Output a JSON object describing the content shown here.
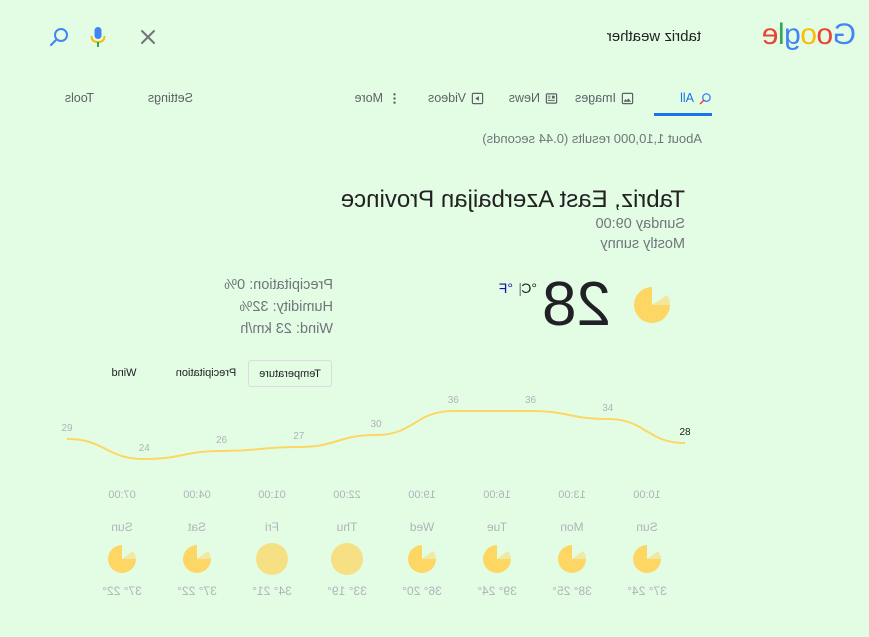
{
  "search": {
    "query": "tabriz weather",
    "logo_letters": [
      {
        "ch": "G",
        "color": "#4285f4"
      },
      {
        "ch": "o",
        "color": "#ea4335"
      },
      {
        "ch": "o",
        "color": "#fbbc05"
      },
      {
        "ch": "g",
        "color": "#4285f4"
      },
      {
        "ch": "l",
        "color": "#34a853"
      },
      {
        "ch": "e",
        "color": "#ea4335"
      }
    ]
  },
  "tabs": {
    "all": "All",
    "images": "Images",
    "news": "News",
    "videos": "Videos",
    "more": "More",
    "settings": "Settings",
    "tools": "Tools"
  },
  "result_stats": "About 1,10,000 results (0.44 seconds)",
  "weather": {
    "location": "Tabriz, East Azerbaijan Province",
    "datetime": "Sunday 09:00",
    "condition": "Mostly sunny",
    "temperature": "28",
    "unit_c": "°C",
    "unit_sep": "|",
    "unit_f": "°F",
    "precipitation": "Precipitation: 0%",
    "humidity": "Humidity: 32%",
    "wind": "Wind: 23 km/h",
    "graph_tabs": {
      "temperature": "Temperature",
      "precipitation": "Precipitation",
      "wind": "Wind"
    },
    "hours": [
      "10:00",
      "13:00",
      "16:00",
      "19:00",
      "22:00",
      "01:00",
      "04:00",
      "07:00"
    ],
    "days": [
      {
        "name": "Sun",
        "icon": "partly-sunny-icon",
        "temps": "37° 24°"
      },
      {
        "name": "Mon",
        "icon": "partly-sunny-icon",
        "temps": "38° 25°"
      },
      {
        "name": "Tue",
        "icon": "partly-sunny-icon",
        "temps": "39° 24°"
      },
      {
        "name": "Wed",
        "icon": "partly-sunny-icon",
        "temps": "36° 20°"
      },
      {
        "name": "Thu",
        "icon": "sunny-icon",
        "temps": "33° 19°"
      },
      {
        "name": "Fri",
        "icon": "sunny-icon",
        "temps": "34° 21°"
      },
      {
        "name": "Sat",
        "icon": "partly-sunny-icon",
        "temps": "37° 22°"
      },
      {
        "name": "Sun",
        "icon": "partly-sunny-icon",
        "temps": "37° 22°"
      }
    ]
  },
  "chart_data": {
    "type": "line",
    "x": [
      "10:00",
      "13:00",
      "16:00",
      "19:00",
      "22:00",
      "01:00",
      "04:00",
      "07:00"
    ],
    "point_labels": [
      "28",
      "34",
      "36",
      "36",
      "30",
      "27",
      "26",
      "24",
      "29"
    ],
    "series": [
      {
        "values": [
          28,
          34,
          36,
          36,
          30,
          27,
          26,
          24,
          29
        ]
      }
    ],
    "line_color": "#fdd663"
  }
}
